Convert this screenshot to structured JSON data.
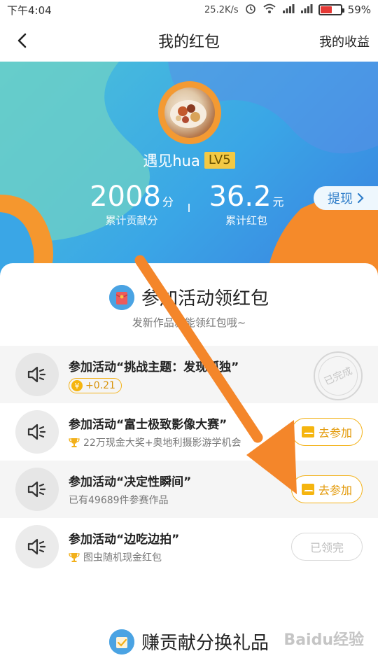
{
  "status_bar": {
    "time": "下午4:04",
    "net_speed": "25.2K/s",
    "battery": "59%",
    "battery_level": 0.59
  },
  "header": {
    "back_icon": "chevron-left-icon",
    "title": "我的红包",
    "right_link": "我的收益"
  },
  "profile": {
    "username": "遇见hua",
    "level": "LV5",
    "points_value": "2008",
    "points_unit": "分",
    "points_label": "累计贡献分",
    "redpacket_value": "36.2",
    "redpacket_unit": "元",
    "redpacket_label": "累计红包",
    "withdraw_label": "提现",
    "withdraw_icon": "chevron-right-icon"
  },
  "section": {
    "title": "参加活动领红包",
    "subtitle": "发新作品就能领红包哦~"
  },
  "activities": [
    {
      "title": "参加活动“挑战主题：发现孤独”",
      "reward": "+0.21",
      "status": "已完成"
    },
    {
      "title": "参加活动“富士极致影像大赛”",
      "desc": "22万现金大奖+奥地利摄影游学机会",
      "button": "去参加"
    },
    {
      "title": "参加活动“决定性瞬间”",
      "desc": "已有49689件参赛作品",
      "button": "去参加"
    },
    {
      "title": "参加活动“边吃边拍”",
      "desc": "图虫随机现金红包",
      "button": "已领完"
    }
  ],
  "section2": {
    "title": "赚贡献分换礼品"
  },
  "watermark": "Baidu经验",
  "colors": {
    "accent": "#f3b21a",
    "arrow": "#f4862a",
    "hero": "#3aa6e6"
  }
}
